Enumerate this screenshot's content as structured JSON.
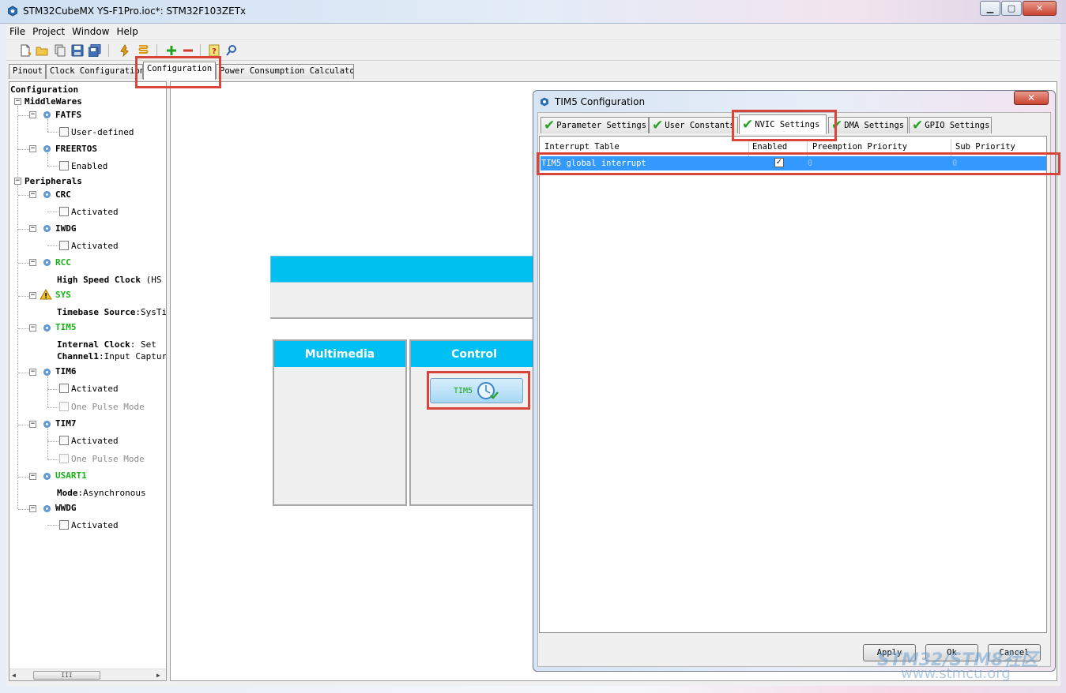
{
  "window": {
    "title": "STM32CubeMX YS-F1Pro.ioc*: STM32F103ZETx",
    "controls": {
      "minimize": "▁",
      "maximize": "▢",
      "close": "✕"
    }
  },
  "menu": [
    "File",
    "Project",
    "Window",
    "Help"
  ],
  "toolbar": {
    "icons": [
      "new-project-icon",
      "open-folder-icon",
      "copy-icon",
      "save-icon",
      "save-all-icon",
      "generate-code-icon",
      "report-icon",
      "add-icon",
      "remove-icon",
      "help-icon",
      "about-icon"
    ]
  },
  "main_tabs": [
    {
      "label": "Pinout",
      "active": false
    },
    {
      "label": "Clock Configuration",
      "active": false
    },
    {
      "label": "Configuration",
      "active": true
    },
    {
      "label": "Power Consumption Calculator",
      "active": false
    }
  ],
  "tree": {
    "root": "Configuration",
    "middlewares": {
      "label": "MiddleWares",
      "fatfs": {
        "label": "FATFS",
        "option": "User-defined"
      },
      "freertos": {
        "label": "FREERTOS",
        "option": "Enabled"
      }
    },
    "peripherals": {
      "label": "Peripherals",
      "crc": {
        "label": "CRC",
        "option": "Activated"
      },
      "iwdg": {
        "label": "IWDG",
        "option": "Activated"
      },
      "rcc": {
        "label": "RCC",
        "setting_key": "High Speed Clock",
        "setting_value": "(HS"
      },
      "sys": {
        "label": "SYS",
        "setting_key": "Timebase Source",
        "setting_value": ":SysTi"
      },
      "tim5": {
        "label": "TIM5",
        "setting1_key": "Internal Clock",
        "setting1_value": ": Set",
        "setting2_key": "Channel1",
        "setting2_value": ":Input Capture"
      },
      "tim6": {
        "label": "TIM6",
        "option1": "Activated",
        "option2": "One Pulse Mode"
      },
      "tim7": {
        "label": "TIM7",
        "option1": "Activated",
        "option2": "One Pulse Mode"
      },
      "usart1": {
        "label": "USART1",
        "setting_key": "Mode",
        "setting_value": ":Asynchronous"
      },
      "wwdg": {
        "label": "WWDG",
        "option": "Activated"
      }
    },
    "scroll_thumb": "III"
  },
  "categories": {
    "multimedia": "Multimedia",
    "control": "Control",
    "tim5_button": "TIM5"
  },
  "dialog": {
    "title": "TIM5 Configuration",
    "close": "✕",
    "tabs": [
      {
        "label": "Parameter Settings",
        "active": false
      },
      {
        "label": "User Constants",
        "active": false
      },
      {
        "label": "NVIC Settings",
        "active": true
      },
      {
        "label": "DMA Settings",
        "active": false
      },
      {
        "label": "GPIO Settings",
        "active": false
      }
    ],
    "table": {
      "columns": [
        "Interrupt Table",
        "Enabled",
        "Preemption Priority",
        "Sub Priority"
      ],
      "rows": [
        {
          "name": "TIM5 global interrupt",
          "enabled": "✓",
          "preemption": "0",
          "sub": "0"
        }
      ]
    },
    "buttons": {
      "apply": "Apply",
      "ok": "Ok",
      "cancel": "Cancel"
    }
  },
  "watermark": {
    "line1": "STM32/STM8社区",
    "line2": "www.stmcu.org"
  },
  "colors": {
    "highlight": "#d9453b",
    "category_header": "#00bff2",
    "selection": "#3399ff",
    "enabled_green": "#17b217"
  }
}
